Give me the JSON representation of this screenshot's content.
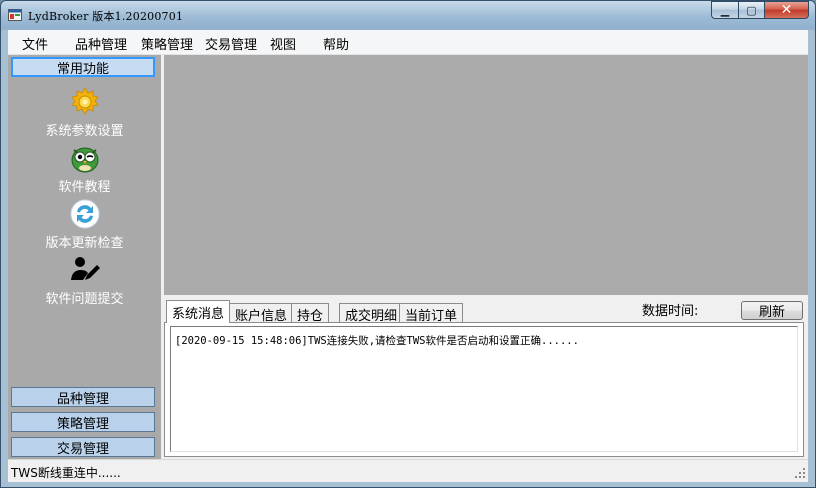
{
  "window": {
    "title": "LydBroker 版本1.20200701",
    "caption": {
      "minimize": "▁",
      "maximize": "▢",
      "close": "✕"
    }
  },
  "menu": {
    "items": [
      "文件",
      "品种管理",
      "策略管理",
      "交易管理",
      "视图",
      "帮助"
    ]
  },
  "sidebar": {
    "common_header": "常用功能",
    "tools": [
      {
        "label": "系统参数设置",
        "icon": "gear-icon"
      },
      {
        "label": "软件教程",
        "icon": "owl-icon"
      },
      {
        "label": "版本更新检查",
        "icon": "refresh-arrows-icon"
      },
      {
        "label": "软件问题提交",
        "icon": "user-edit-icon"
      }
    ],
    "bottom_headers": [
      "品种管理",
      "策略管理",
      "交易管理"
    ]
  },
  "messages": {
    "tabs": [
      "系统消息",
      "账户信息",
      "持仓",
      "成交明细",
      "当前订单"
    ],
    "active_tab": "系统消息",
    "data_time_label": "数据时间:",
    "refresh_label": "刷新",
    "log": [
      "[2020-09-15 15:48:06]TWS连接失败,请检查TWS软件是否启动和设置正确......"
    ]
  },
  "status": {
    "text": "TWS断线重连中......"
  },
  "colors": {
    "mdi_background": "#ababab",
    "sidebar_background": "#a9a9a9",
    "nav_header": "#b9d1ea",
    "selected_border": "#3399ff"
  }
}
